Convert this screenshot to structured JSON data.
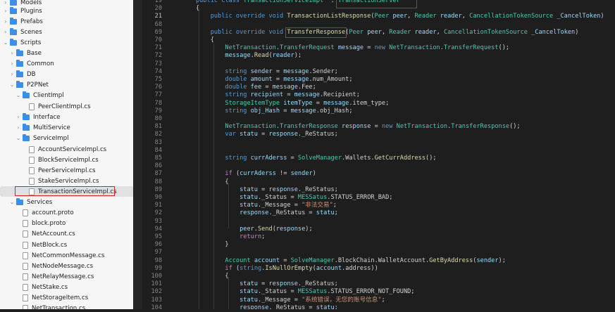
{
  "sidebar": {
    "items": [
      {
        "label": "Models",
        "kind": "folder",
        "expanded": false,
        "depth": 0
      },
      {
        "label": "Plugins",
        "kind": "folder",
        "expanded": false,
        "depth": 0
      },
      {
        "label": "Prefabs",
        "kind": "folder",
        "expanded": false,
        "depth": 0
      },
      {
        "label": "Scenes",
        "kind": "folder",
        "expanded": false,
        "depth": 0
      },
      {
        "label": "Scripts",
        "kind": "folder",
        "expanded": true,
        "depth": 0
      },
      {
        "label": "Base",
        "kind": "folder",
        "expanded": false,
        "depth": 1
      },
      {
        "label": "Common",
        "kind": "folder",
        "expanded": false,
        "depth": 1
      },
      {
        "label": "DB",
        "kind": "folder",
        "expanded": false,
        "depth": 1
      },
      {
        "label": "P2PNet",
        "kind": "folder",
        "expanded": true,
        "depth": 1
      },
      {
        "label": "ClientImpl",
        "kind": "folder",
        "expanded": true,
        "depth": 2
      },
      {
        "label": "PeerClientImpl.cs",
        "kind": "file",
        "depth": 3
      },
      {
        "label": "Interface",
        "kind": "folder",
        "expanded": false,
        "depth": 2
      },
      {
        "label": "MultiService",
        "kind": "folder",
        "expanded": false,
        "depth": 2
      },
      {
        "label": "ServiceImpl",
        "kind": "folder",
        "expanded": true,
        "depth": 2
      },
      {
        "label": "AccountServiceImpl.cs",
        "kind": "file",
        "depth": 3
      },
      {
        "label": "BlockServiceImpl.cs",
        "kind": "file",
        "depth": 3
      },
      {
        "label": "PeerServiceImpl.cs",
        "kind": "file",
        "depth": 3
      },
      {
        "label": "StakeServiceImpl.cs",
        "kind": "file",
        "depth": 3
      },
      {
        "label": "TransactionServiceImpl.cs",
        "kind": "file",
        "depth": 3,
        "selected": true
      },
      {
        "label": "Services",
        "kind": "folder",
        "expanded": true,
        "depth": 1
      },
      {
        "label": "account.proto",
        "kind": "file",
        "depth": 2
      },
      {
        "label": "block.proto",
        "kind": "file",
        "depth": 2
      },
      {
        "label": "NetAccount.cs",
        "kind": "file",
        "depth": 2
      },
      {
        "label": "NetBlock.cs",
        "kind": "file",
        "depth": 2
      },
      {
        "label": "NetCommonMessage.cs",
        "kind": "file",
        "depth": 2
      },
      {
        "label": "NetNodeMessage.cs",
        "kind": "file",
        "depth": 2
      },
      {
        "label": "NetRelayMessage.cs",
        "kind": "file",
        "depth": 2
      },
      {
        "label": "NetStake.cs",
        "kind": "file",
        "depth": 2
      },
      {
        "label": "NetStorageItem.cs",
        "kind": "file",
        "depth": 2
      },
      {
        "label": "NetTransaction.cs",
        "kind": "file",
        "depth": 2
      }
    ]
  },
  "editor": {
    "active_line": "21",
    "lines": [
      {
        "n": "19",
        "tokens": [
          [
            "kw",
            "public class "
          ],
          [
            "ty",
            "TransactionServiceImpl"
          ],
          [
            "",
            "  : "
          ],
          [
            "ty",
            "TransactionServer"
          ]
        ]
      },
      {
        "n": "20",
        "tokens": [
          [
            "",
            "{"
          ]
        ]
      },
      {
        "n": "21",
        "tokens": [
          [
            "",
            "    "
          ],
          [
            "kw",
            "public override void "
          ],
          [
            "fn",
            "TransactionListResponse"
          ],
          [
            "",
            "("
          ],
          [
            "ty",
            "Peer"
          ],
          [
            "",
            " "
          ],
          [
            "vr",
            "peer"
          ],
          [
            "",
            ", "
          ],
          [
            "ty",
            "Reader"
          ],
          [
            "",
            " "
          ],
          [
            "vr",
            "reader"
          ],
          [
            "",
            ", "
          ],
          [
            "ty",
            "CancellationTokenSource"
          ],
          [
            "",
            " "
          ],
          [
            "vr",
            "_CancelToken"
          ],
          [
            "",
            ")"
          ]
        ]
      },
      {
        "n": "68",
        "tokens": []
      },
      {
        "n": "69",
        "tokens": [
          [
            "",
            "    "
          ],
          [
            "kw",
            "public override void "
          ],
          [
            "fn",
            "TransferResponse"
          ],
          [
            "",
            "("
          ],
          [
            "ty",
            "Peer"
          ],
          [
            "",
            " "
          ],
          [
            "vr",
            "peer"
          ],
          [
            "",
            ", "
          ],
          [
            "ty",
            "Reader"
          ],
          [
            "",
            " "
          ],
          [
            "vr",
            "reader"
          ],
          [
            "",
            ", "
          ],
          [
            "ty",
            "CancellationTokenSource"
          ],
          [
            "",
            " "
          ],
          [
            "vr",
            "_CancelToken"
          ],
          [
            "",
            ")"
          ]
        ]
      },
      {
        "n": "70",
        "tokens": [
          [
            "",
            "    {"
          ]
        ]
      },
      {
        "n": "71",
        "tokens": [
          [
            "",
            "        "
          ],
          [
            "ty",
            "NetTransaction"
          ],
          [
            "",
            "."
          ],
          [
            "ty",
            "TransferRequest"
          ],
          [
            "",
            " "
          ],
          [
            "vr",
            "message"
          ],
          [
            "",
            " = "
          ],
          [
            "kw",
            "new "
          ],
          [
            "ty",
            "NetTransaction"
          ],
          [
            "",
            "."
          ],
          [
            "ty",
            "TransferRequest"
          ],
          [
            "",
            "();"
          ]
        ]
      },
      {
        "n": "72",
        "tokens": [
          [
            "",
            "        "
          ],
          [
            "vr",
            "message"
          ],
          [
            "",
            "."
          ],
          [
            "fn",
            "Read"
          ],
          [
            "",
            "("
          ],
          [
            "vr",
            "reader"
          ],
          [
            "",
            ");"
          ]
        ]
      },
      {
        "n": "73",
        "tokens": []
      },
      {
        "n": "74",
        "tokens": [
          [
            "",
            "        "
          ],
          [
            "kw",
            "string "
          ],
          [
            "vr",
            "sender"
          ],
          [
            "",
            " = "
          ],
          [
            "vr",
            "message"
          ],
          [
            "",
            ".Sender;"
          ]
        ]
      },
      {
        "n": "75",
        "tokens": [
          [
            "",
            "        "
          ],
          [
            "kw",
            "double "
          ],
          [
            "vr",
            "amount"
          ],
          [
            "",
            " = "
          ],
          [
            "vr",
            "message"
          ],
          [
            "",
            ".num_Amount;"
          ]
        ]
      },
      {
        "n": "76",
        "tokens": [
          [
            "",
            "        "
          ],
          [
            "kw",
            "double "
          ],
          [
            "vr",
            "fee"
          ],
          [
            "",
            " = "
          ],
          [
            "vr",
            "message"
          ],
          [
            "",
            ".Fee;"
          ]
        ]
      },
      {
        "n": "77",
        "tokens": [
          [
            "",
            "        "
          ],
          [
            "kw",
            "string "
          ],
          [
            "vr",
            "recipient"
          ],
          [
            "",
            " = "
          ],
          [
            "vr",
            "message"
          ],
          [
            "",
            ".Recipient;"
          ]
        ]
      },
      {
        "n": "78",
        "tokens": [
          [
            "",
            "        "
          ],
          [
            "ty",
            "StorageItemType"
          ],
          [
            "",
            " "
          ],
          [
            "vr",
            "itemType"
          ],
          [
            "",
            " = "
          ],
          [
            "vr",
            "message"
          ],
          [
            "",
            ".item_type;"
          ]
        ]
      },
      {
        "n": "79",
        "tokens": [
          [
            "",
            "        "
          ],
          [
            "kw",
            "string "
          ],
          [
            "vr",
            "obj_Hash"
          ],
          [
            "",
            " = "
          ],
          [
            "vr",
            "message"
          ],
          [
            "",
            ".obj_Hash;"
          ]
        ]
      },
      {
        "n": "80",
        "tokens": []
      },
      {
        "n": "81",
        "tokens": [
          [
            "",
            "        "
          ],
          [
            "ty",
            "NetTransaction"
          ],
          [
            "",
            "."
          ],
          [
            "ty",
            "TransferResponse"
          ],
          [
            "",
            " "
          ],
          [
            "vr",
            "response"
          ],
          [
            "",
            " = "
          ],
          [
            "kw",
            "new "
          ],
          [
            "ty",
            "NetTransaction"
          ],
          [
            "",
            "."
          ],
          [
            "ty",
            "TransferResponse"
          ],
          [
            "",
            "();"
          ]
        ]
      },
      {
        "n": "82",
        "tokens": [
          [
            "",
            "        "
          ],
          [
            "kw",
            "var "
          ],
          [
            "vr",
            "statu"
          ],
          [
            "",
            " = "
          ],
          [
            "vr",
            "response"
          ],
          [
            "",
            "._ReStatus;"
          ]
        ]
      },
      {
        "n": "83",
        "tokens": []
      },
      {
        "n": "84",
        "tokens": []
      },
      {
        "n": "85",
        "tokens": [
          [
            "",
            "        "
          ],
          [
            "kw",
            "string "
          ],
          [
            "vr",
            "currAderss"
          ],
          [
            "",
            " = "
          ],
          [
            "ty",
            "SolveManager"
          ],
          [
            "",
            ".Wallets."
          ],
          [
            "fn",
            "GetCurrAddress"
          ],
          [
            "",
            "();"
          ]
        ]
      },
      {
        "n": "86",
        "tokens": []
      },
      {
        "n": "87",
        "tokens": [
          [
            "",
            "        "
          ],
          [
            "ct",
            "if "
          ],
          [
            "",
            "("
          ],
          [
            "vr",
            "currAderss"
          ],
          [
            "",
            " != "
          ],
          [
            "vr",
            "sender"
          ],
          [
            "",
            ")"
          ]
        ]
      },
      {
        "n": "88",
        "tokens": [
          [
            "",
            "        {"
          ]
        ]
      },
      {
        "n": "89",
        "tokens": [
          [
            "",
            "            "
          ],
          [
            "vr",
            "statu"
          ],
          [
            "",
            " = "
          ],
          [
            "vr",
            "response"
          ],
          [
            "",
            "._ReStatus;"
          ]
        ]
      },
      {
        "n": "90",
        "tokens": [
          [
            "",
            "            "
          ],
          [
            "vr",
            "statu"
          ],
          [
            "",
            "._Status = "
          ],
          [
            "ty",
            "MESSatus"
          ],
          [
            "",
            ".STATUS_ERROR_BAD;"
          ]
        ]
      },
      {
        "n": "91",
        "tokens": [
          [
            "",
            "            "
          ],
          [
            "vr",
            "statu"
          ],
          [
            "",
            "._Message = "
          ],
          [
            "st",
            "\"非法交易\""
          ],
          [
            "",
            ";"
          ]
        ]
      },
      {
        "n": "92",
        "tokens": [
          [
            "",
            "            "
          ],
          [
            "vr",
            "response"
          ],
          [
            "",
            "._ReStatus = "
          ],
          [
            "vr",
            "statu"
          ],
          [
            "",
            ";"
          ]
        ]
      },
      {
        "n": "93",
        "tokens": []
      },
      {
        "n": "94",
        "tokens": [
          [
            "",
            "            "
          ],
          [
            "vr",
            "peer"
          ],
          [
            "",
            "."
          ],
          [
            "fn",
            "Send"
          ],
          [
            "",
            "("
          ],
          [
            "vr",
            "response"
          ],
          [
            "",
            ");"
          ]
        ]
      },
      {
        "n": "95",
        "tokens": [
          [
            "",
            "            "
          ],
          [
            "ct",
            "return"
          ],
          [
            "",
            ";"
          ]
        ]
      },
      {
        "n": "96",
        "tokens": [
          [
            "",
            "        }"
          ]
        ]
      },
      {
        "n": "97",
        "tokens": []
      },
      {
        "n": "98",
        "tokens": [
          [
            "",
            "        "
          ],
          [
            "ty",
            "Account"
          ],
          [
            "",
            " "
          ],
          [
            "vr",
            "account"
          ],
          [
            "",
            " = "
          ],
          [
            "ty",
            "SolveManager"
          ],
          [
            "",
            ".BlockChain.WalletAccount."
          ],
          [
            "fn",
            "GetByAddress"
          ],
          [
            "",
            "("
          ],
          [
            "vr",
            "sender"
          ],
          [
            "",
            ");"
          ]
        ]
      },
      {
        "n": "99",
        "tokens": [
          [
            "",
            "        "
          ],
          [
            "ct",
            "if "
          ],
          [
            "",
            "("
          ],
          [
            "kw",
            "string"
          ],
          [
            "",
            "."
          ],
          [
            "fn",
            "IsNullOrEmpty"
          ],
          [
            "",
            "("
          ],
          [
            "vr",
            "account"
          ],
          [
            "",
            ".address))"
          ]
        ]
      },
      {
        "n": "100",
        "tokens": [
          [
            "",
            "        {"
          ]
        ]
      },
      {
        "n": "101",
        "tokens": [
          [
            "",
            "            "
          ],
          [
            "vr",
            "statu"
          ],
          [
            "",
            " = "
          ],
          [
            "vr",
            "response"
          ],
          [
            "",
            "._ReStatus;"
          ]
        ]
      },
      {
        "n": "102",
        "tokens": [
          [
            "",
            "            "
          ],
          [
            "vr",
            "statu"
          ],
          [
            "",
            "._Status = "
          ],
          [
            "ty",
            "MESSatus"
          ],
          [
            "",
            ".STATUS_ERROR_NOT_FOUND;"
          ]
        ]
      },
      {
        "n": "103",
        "tokens": [
          [
            "",
            "            "
          ],
          [
            "vr",
            "statu"
          ],
          [
            "",
            "._Message = "
          ],
          [
            "st",
            "\"系统错误，无您的账号信息\""
          ],
          [
            "",
            ";"
          ]
        ]
      },
      {
        "n": "104",
        "tokens": [
          [
            "",
            "            "
          ],
          [
            "vr",
            "response"
          ],
          [
            "",
            "._ReStatus = "
          ],
          [
            "vr",
            "statu"
          ],
          [
            "",
            ";"
          ]
        ]
      }
    ]
  }
}
